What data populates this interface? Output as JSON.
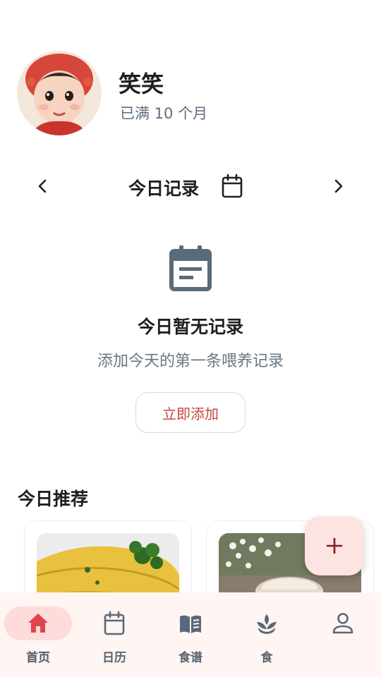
{
  "profile": {
    "name": "笑笑",
    "age": "已满 10 个月"
  },
  "date_nav": {
    "title": "今日记录"
  },
  "empty_state": {
    "title": "今日暂无记录",
    "subtitle": "添加今天的第一条喂养记录",
    "button_label": "立即添加"
  },
  "recommendations": {
    "title": "今日推荐"
  },
  "fab": {
    "label": "+"
  },
  "bottom_nav": {
    "items": [
      {
        "label": "首页",
        "icon": "home-icon",
        "active": true
      },
      {
        "label": "日历",
        "icon": "calendar-icon",
        "active": false
      },
      {
        "label": "食谱",
        "icon": "book-icon",
        "active": false
      },
      {
        "label": "食",
        "icon": "leaf-icon",
        "active": false
      },
      {
        "label": "",
        "icon": "user-icon",
        "active": false
      }
    ]
  },
  "colors": {
    "accent": "#e0454b",
    "nav_bg": "#fff5f3",
    "fab_bg": "#fde3e2",
    "icon_slate": "#5a6878"
  }
}
